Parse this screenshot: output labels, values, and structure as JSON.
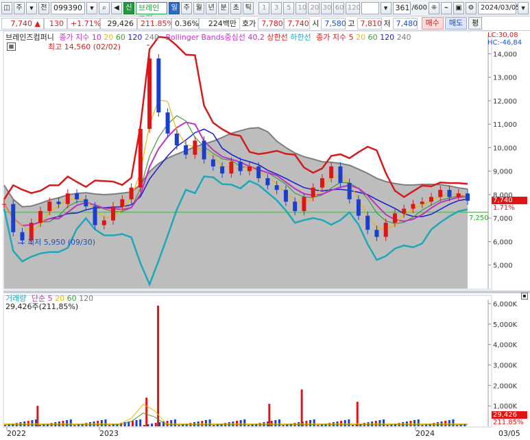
{
  "toolbar": {
    "layout_btn": "◫",
    "market": "주",
    "all": "전",
    "code": "099390",
    "back": "◀",
    "search": "🔍",
    "sin": "신",
    "name": "브레인즈컴",
    "periods": [
      "일",
      "주",
      "월",
      "년",
      "분",
      "초",
      "틱"
    ],
    "active_period": "일",
    "minutes": [
      "1",
      "3",
      "5",
      "10",
      "20",
      "30",
      "60",
      "120"
    ],
    "count": "361",
    "count_total": "/600",
    "date": "2024/03/05"
  },
  "quote": {
    "price": "7,740",
    "arrow": "▲",
    "change": "130",
    "change_pct": "+1.71%",
    "volume": "29,426",
    "vol_pct": "211.85%",
    "turnover": "0.36%",
    "amount": "224백만",
    "ask_label": "호가",
    "ask": "7,780",
    "bid": "7,740",
    "open_label": "시",
    "open": "7,580",
    "high_label": "고",
    "high": "7,810",
    "low_label": "저",
    "low": "7,480",
    "buy": "매수",
    "sell": "매도",
    "flat": "평"
  },
  "legend": {
    "name": "브레인즈컴퍼니",
    "ma_close": "종가 지수",
    "ma_periods": [
      "10",
      "20",
      "60",
      "120",
      "240"
    ],
    "bollinger": "Bollinger Bands중심선 40,2",
    "upper": "상한선",
    "lower": "하한선",
    "ma5_label": "종가 지수 5",
    "ma5_periods": [
      "20",
      "60",
      "120",
      "240"
    ],
    "lc": "LC:30,08",
    "hc": "HC:-46,84"
  },
  "annotations": {
    "high": "최고 14,560 (02/02)",
    "low": "최저 5,950 (09/30)",
    "price_tag": "7,740",
    "pct_tag": "1.71%",
    "green_line": "7,250"
  },
  "volume_legend": {
    "label": "거래량",
    "ma_label": "단순 5",
    "ma_periods": [
      "20",
      "60",
      "120"
    ],
    "value": "29,426주(211,85%)",
    "tag_value": "29,426",
    "tag_pct": "211.85%"
  },
  "xaxis": [
    "2022",
    "2023",
    "2024",
    "03/05"
  ],
  "colors": {
    "up": "#e01414",
    "down": "#1a3fd0",
    "ma5": "#e8b800",
    "ma20": "#9c9c00",
    "ma60": "#3c9a3c",
    "ma120": "#1a1ad0",
    "ma240": "#7d7d7d",
    "bb_mid": "#c030c0",
    "bb_upper": "#d41a1a",
    "bb_lower": "#1ca8b8",
    "band_fill": "#bdbdbd",
    "hline": "#33dd33"
  },
  "chart_data": {
    "type": "line",
    "title": "",
    "ylabel": "",
    "xlabel": "",
    "ylim": [
      4000,
      14800
    ],
    "yticks": [
      5000,
      6000,
      7000,
      8000,
      9000,
      10000,
      11000,
      12000,
      13000,
      14000
    ],
    "ytick_labels": [
      "5,000",
      "6,000",
      "7,000",
      "8,000",
      "9,000",
      "10,000",
      "11,000",
      "12,000",
      "13,000",
      "14,000"
    ],
    "x_labels": [
      "2022",
      "2023",
      "2024"
    ],
    "hline": 7250,
    "last_price": 7740,
    "series": [
      {
        "name": "",
        "values": [
          7600,
          6400,
          6050,
          6800,
          7300,
          7700,
          7600,
          8050,
          7800,
          7500,
          6700,
          6900,
          7500,
          7800,
          8300,
          10800,
          13800,
          11500,
          10600,
          10100,
          9700,
          10300,
          9500,
          9200,
          8900,
          9400,
          9000,
          9200,
          8700,
          8400,
          8200,
          7700,
          7300,
          7900,
          8300,
          8700,
          9200,
          8500,
          7800,
          7100,
          6500,
          6200,
          6800,
          7200,
          7400,
          7600,
          7700,
          7900,
          8200,
          7900,
          8050,
          7740
        ]
      }
    ],
    "volume": {
      "ylim": [
        0,
        6200000
      ],
      "yticks": [
        1000000,
        2000000,
        3000000,
        4000000,
        5000000,
        6000000
      ],
      "ytick_labels": [
        "1,000K",
        "2,000K",
        "3,000K",
        "4,000K",
        "5,000K",
        "6,000K"
      ],
      "spikes": [
        [
          0.07,
          1000000
        ],
        [
          0.305,
          1400000
        ],
        [
          0.33,
          5900000
        ],
        [
          0.57,
          1100000
        ],
        [
          0.64,
          1800000
        ],
        [
          0.76,
          1200000
        ]
      ]
    }
  }
}
